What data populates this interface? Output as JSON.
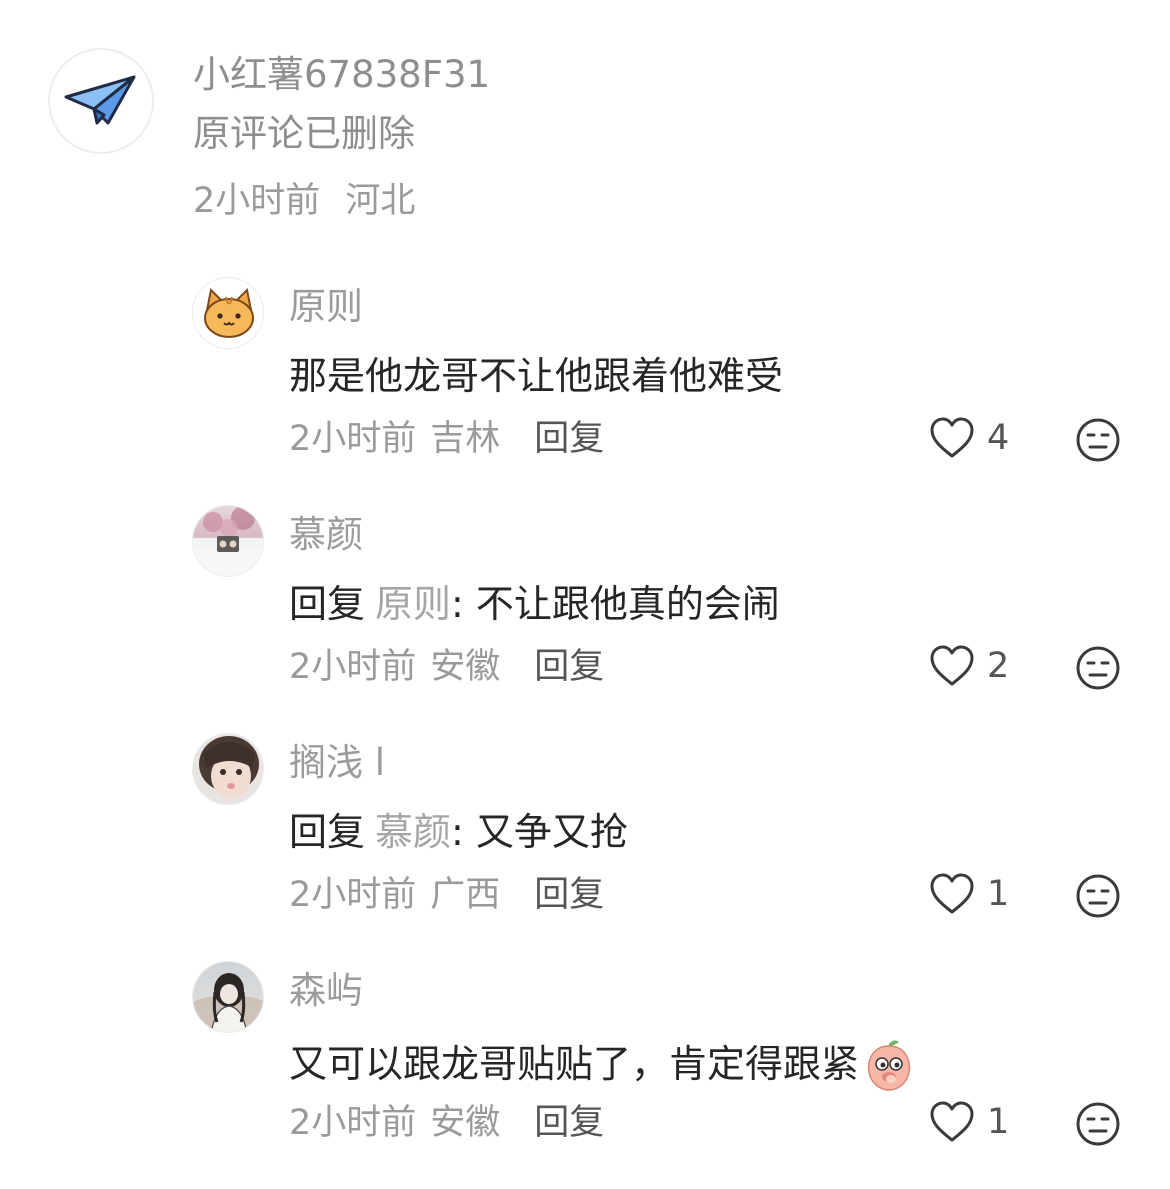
{
  "root": {
    "username": "小红薯67838F31",
    "text": "原评论已删除",
    "time": "2小时前",
    "location": "河北",
    "avatar_icon": "paper-plane-icon"
  },
  "replies": [
    {
      "username": "原则",
      "avatar": "cat-avatar",
      "prefix": "",
      "target": "",
      "content": "那是他龙哥不让他跟着他难受",
      "time": "2小时前",
      "location": "吉林",
      "reply_label": "回复",
      "likes": "4"
    },
    {
      "username": "慕颜",
      "avatar": "photo-avatar",
      "prefix": "回复",
      "target": "原则",
      "sep": ":",
      "content": "不让跟他真的会闹",
      "time": "2小时前",
      "location": "安徽",
      "reply_label": "回复",
      "likes": "2"
    },
    {
      "username": "搁浅 l",
      "avatar": "girl-avatar",
      "prefix": "回复",
      "target": "慕颜",
      "sep": ":",
      "content": "又争又抢",
      "time": "2小时前",
      "location": "广西",
      "reply_label": "回复",
      "likes": "1"
    },
    {
      "username": "森屿",
      "avatar": "girl-sketch-avatar",
      "prefix": "",
      "target": "",
      "content": "又可以跟龙哥贴贴了，肯定得跟紧",
      "emoji": "peach-emoji",
      "time": "2小时前",
      "location": "安徽",
      "reply_label": "回复",
      "likes": "1"
    }
  ],
  "colors": {
    "text_primary": "#262626",
    "text_secondary": "#9a9a9a",
    "paper_plane": "#6aa8ee"
  }
}
